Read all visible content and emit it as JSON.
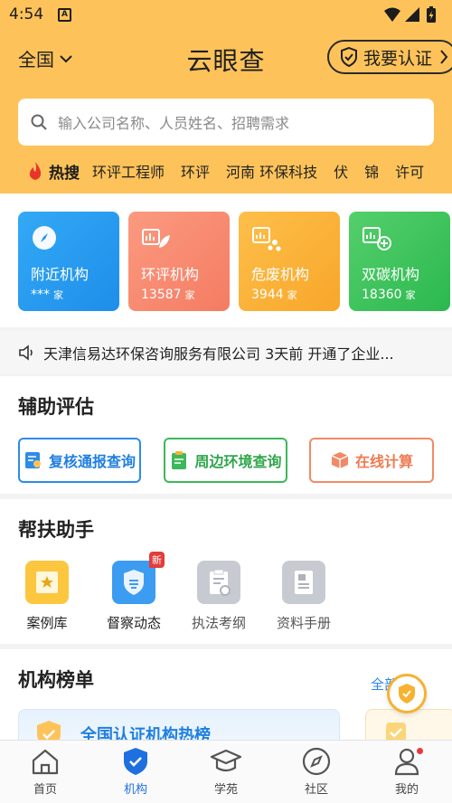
{
  "status_bar": {
    "time": "4:54",
    "sim_letter": "A"
  },
  "header": {
    "region": "全国",
    "title": "云眼查",
    "certify_label": "我要认证"
  },
  "search": {
    "placeholder": "输入公司名称、人员姓名、招聘需求"
  },
  "hot_search": {
    "label": "热搜",
    "keywords": [
      "环评工程师",
      "环评",
      "河南 环保科技",
      "伏",
      "锦",
      "许可"
    ]
  },
  "categories": [
    {
      "name": "附近机构",
      "count": "***",
      "unit": "家",
      "icon": "compass-icon",
      "color": "#1e8eea"
    },
    {
      "name": "环评机构",
      "count": "13587",
      "unit": "家",
      "icon": "eia-chart-leaf-icon",
      "color": "#f47c62"
    },
    {
      "name": "危废机构",
      "count": "3944",
      "unit": "家",
      "icon": "hazard-chart-icon",
      "color": "#f8a62a"
    },
    {
      "name": "双碳机构",
      "count": "18360",
      "unit": "家",
      "icon": "carbon-chart-icon",
      "color": "#2cb84f"
    }
  ],
  "notice": {
    "text": "天津信易达环保咨询服务有限公司 3天前 开通了企业..."
  },
  "assist": {
    "title": "辅助评估",
    "buttons": [
      "复核通报查询",
      "周边环境查询",
      "在线计算"
    ]
  },
  "helper": {
    "title": "帮扶助手",
    "items": [
      {
        "label": "案例库",
        "icon": "case-library-icon"
      },
      {
        "label": "督察动态",
        "icon": "inspection-shield-icon",
        "badge": "新"
      },
      {
        "label": "执法考纲",
        "icon": "law-clipboard-icon"
      },
      {
        "label": "资料手册",
        "icon": "manual-document-icon"
      }
    ]
  },
  "ranking": {
    "title": "机构榜单",
    "more": "全部",
    "card_title": "全国认证机构热榜"
  },
  "tabs": [
    {
      "label": "首页",
      "icon": "home-icon"
    },
    {
      "label": "机构",
      "icon": "shield-check-icon",
      "active": true
    },
    {
      "label": "学苑",
      "icon": "graduation-cap-icon"
    },
    {
      "label": "社区",
      "icon": "compass-icon"
    },
    {
      "label": "我的",
      "icon": "user-icon"
    }
  ],
  "colors": {
    "header_bg": "#fdc35a",
    "accent_blue": "#1f6fe0",
    "badge_red": "#e53b3b"
  }
}
